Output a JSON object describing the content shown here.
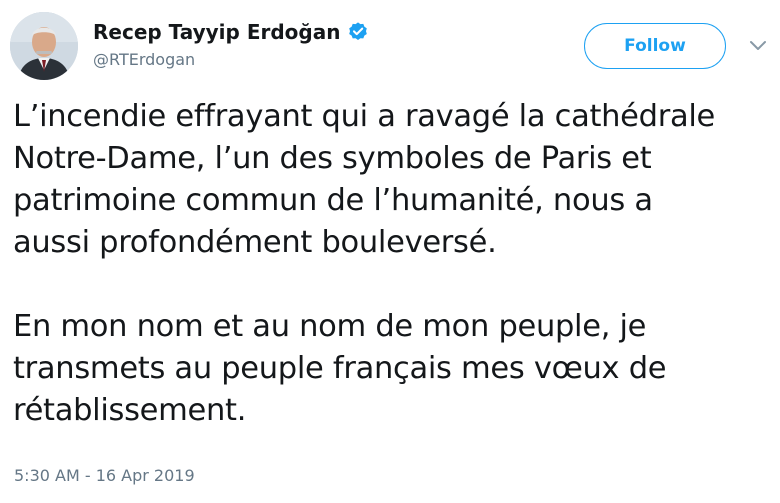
{
  "user": {
    "display_name": "Recep Tayyip Erdoğan",
    "handle": "@RTErdogan",
    "verified_icon": "verified-badge-icon",
    "verified_color": "#1da1f2"
  },
  "actions": {
    "follow_label": "Follow",
    "more_icon": "chevron-down-icon"
  },
  "tweet": {
    "paragraph1": [
      "L’incendie effrayant qui a ravagé la cathédrale",
      "Notre-Dame, l’un des symboles de Paris et",
      "patrimoine commun de l’humanité, nous a",
      "aussi profondément bouleversé."
    ],
    "paragraph2": [
      "En mon nom et au nom de mon peuple, je",
      "transmets au peuple français mes vœux de",
      "rétablissement."
    ]
  },
  "meta": {
    "timestamp": "5:30 AM - 16 Apr 2019"
  },
  "colors": {
    "accent": "#1da1f2",
    "text": "#14171a",
    "muted": "#657786"
  }
}
